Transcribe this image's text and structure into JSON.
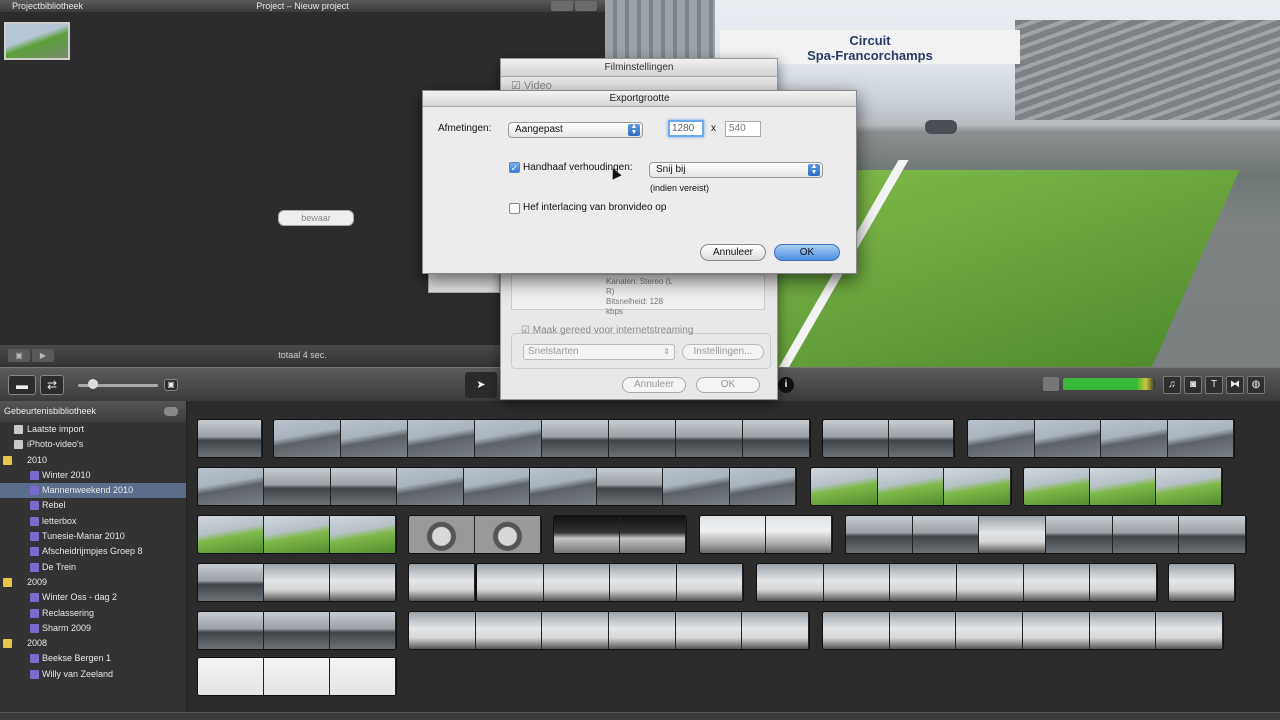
{
  "project_library": {
    "title": "Projectbibliotheek",
    "project_title": "Project – Nieuw project",
    "total": "totaal 4 sec."
  },
  "viewer": {
    "banner_line1": "Circuit",
    "banner_line2": "Spa-Francorchamps"
  },
  "toolbar": {
    "info_icon": "info-icon"
  },
  "event_library": {
    "title": "Gebeurtenisbibliotheek",
    "rows": [
      {
        "label": "Laatste import",
        "kind": "top"
      },
      {
        "label": "iPhoto-video's",
        "kind": "top"
      },
      {
        "label": "2010",
        "kind": "year"
      },
      {
        "label": "Winter 2010",
        "kind": "item"
      },
      {
        "label": "Mannenweekend 2010",
        "kind": "item",
        "selected": true
      },
      {
        "label": "Rebel",
        "kind": "item"
      },
      {
        "label": "letterbox",
        "kind": "item"
      },
      {
        "label": "Tunesie-Manar 2010",
        "kind": "item"
      },
      {
        "label": "Afscheidrijmpjes Groep 8",
        "kind": "item"
      },
      {
        "label": "De Trein",
        "kind": "item"
      },
      {
        "label": "2009",
        "kind": "year"
      },
      {
        "label": "Winter Oss - dag 2",
        "kind": "item"
      },
      {
        "label": "Reclassering",
        "kind": "item"
      },
      {
        "label": "Sharm 2009",
        "kind": "item"
      },
      {
        "label": "2008",
        "kind": "year"
      },
      {
        "label": "Beekse Bergen 1",
        "kind": "item"
      },
      {
        "label": "Willy van Zeeland",
        "kind": "item"
      }
    ]
  },
  "film_dialog": {
    "title": "Filminstellingen",
    "video_label": "Video",
    "audio_info_line1": "Kanalen: Stereo (L R)",
    "audio_info_line2": "Bitsnelheid: 128 kbps",
    "side_button": "bewaar",
    "stream_label": "Maak gereed voor internetstreaming",
    "quick_start": "Snelstarten",
    "settings_button": "Instellingen...",
    "cancel": "Annuleer",
    "ok": "OK"
  },
  "export_dialog": {
    "title": "Exportgrootte",
    "dimensions_label": "Afmetingen:",
    "dimensions_value": "Aangepast",
    "width": "1280",
    "times": "x",
    "height": "540",
    "aspect_label": "Handhaaf verhoudingen:",
    "aspect_checked": true,
    "aspect_value": "Snij bij",
    "aspect_note": "(indien vereist)",
    "deinterlace_label": "Hef interlacing van bronvideo op",
    "deinterlace_checked": false,
    "cancel": "Annuleer",
    "ok": "OK"
  }
}
